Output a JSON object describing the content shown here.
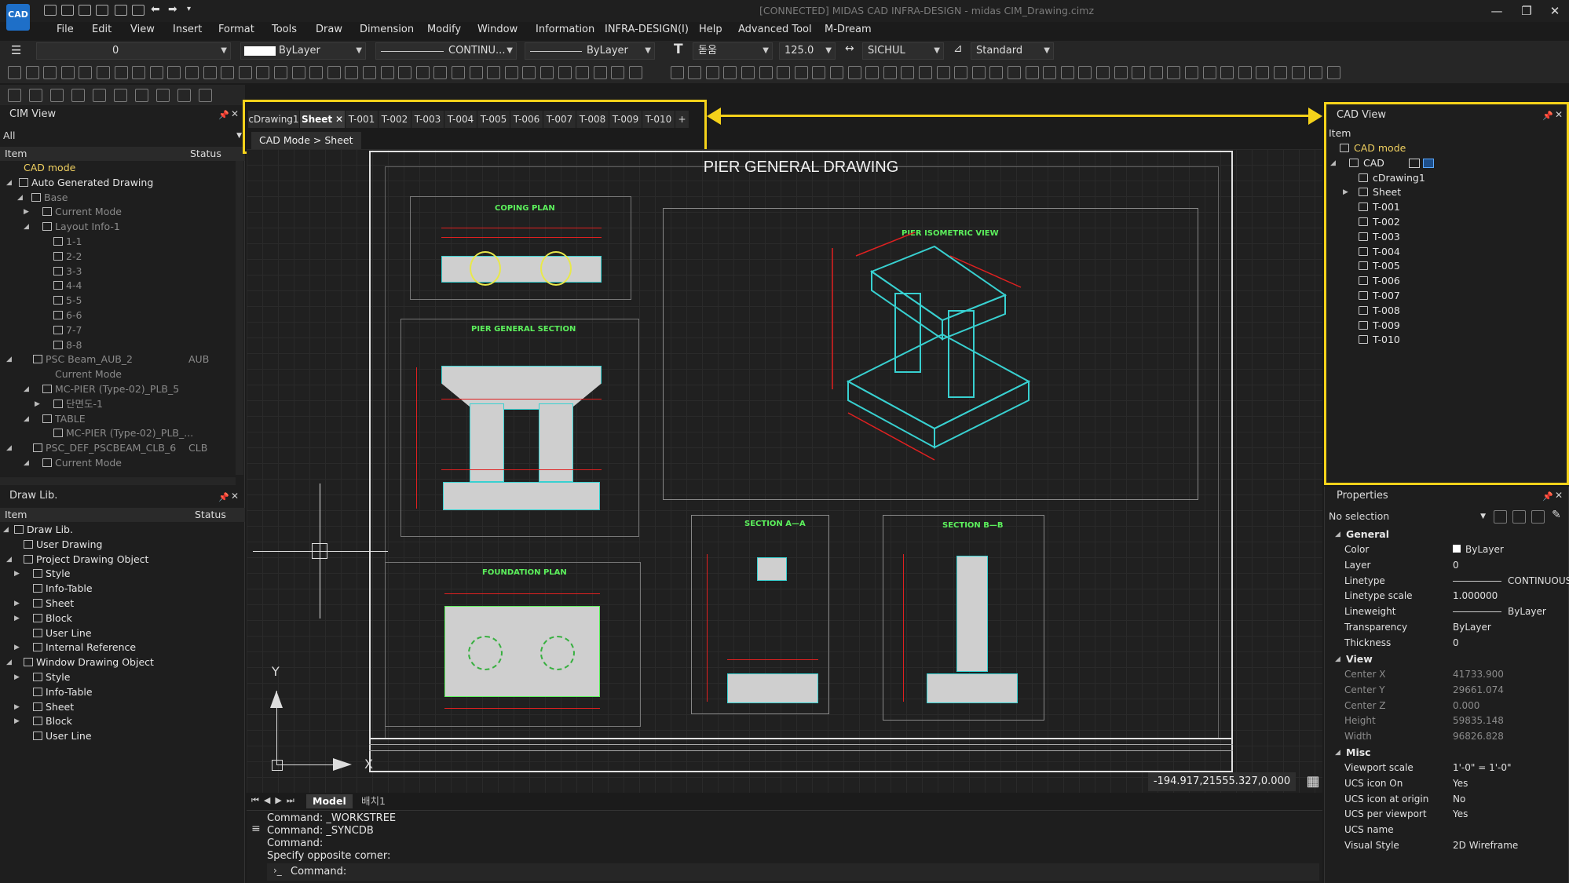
{
  "window": {
    "logo": "CAD",
    "title": "[CONNECTED] MIDAS CAD INFRA-DESIGN - midas CIM_Drawing.cimz",
    "controls": [
      "—",
      "❐",
      "✕"
    ]
  },
  "menu": [
    "File",
    "Edit",
    "View",
    "Insert",
    "Format",
    "Tools",
    "Draw",
    "Dimension",
    "Modify",
    "Window",
    "Information",
    "INFRA-DESIGN(I)",
    "Help",
    "Advanced Tool",
    "M-Dream"
  ],
  "toolbar": {
    "layer_value": "0",
    "color_value": "ByLayer",
    "linetype_value": "CONTINU...",
    "lineweight_value": "ByLayer",
    "text_style": "돋움",
    "text_height": "125.0",
    "dim_style": "SICHUL",
    "table_style": "Standard"
  },
  "cim_view": {
    "title": "CIM View",
    "filter": "All",
    "col_item": "Item",
    "col_status": "Status",
    "rows": [
      {
        "label": "CAD mode",
        "status": ""
      },
      {
        "label": "Auto Generated Drawing",
        "status": ""
      },
      {
        "label": "Base",
        "status": ""
      },
      {
        "label": "Current Mode",
        "status": ""
      },
      {
        "label": "Layout Info-1",
        "status": ""
      },
      {
        "label": "1-1",
        "status": ""
      },
      {
        "label": "2-2",
        "status": ""
      },
      {
        "label": "3-3",
        "status": ""
      },
      {
        "label": "4-4",
        "status": ""
      },
      {
        "label": "5-5",
        "status": ""
      },
      {
        "label": "6-6",
        "status": ""
      },
      {
        "label": "7-7",
        "status": ""
      },
      {
        "label": "8-8",
        "status": ""
      },
      {
        "label": "PSC Beam_AUB_2",
        "status": "AUB"
      },
      {
        "label": "Current Mode",
        "status": ""
      },
      {
        "label": "MC-PIER (Type-02)_PLB_5",
        "status": ""
      },
      {
        "label": "단면도-1",
        "status": ""
      },
      {
        "label": "TABLE",
        "status": ""
      },
      {
        "label": "MC-PIER (Type-02)_PLB_...",
        "status": ""
      },
      {
        "label": "PSC_DEF_PSCBEAM_CLB_6",
        "status": "CLB"
      },
      {
        "label": "Current Mode",
        "status": ""
      }
    ]
  },
  "draw_lib": {
    "title": "Draw Lib.",
    "col_item": "Item",
    "col_status": "Status",
    "rows": [
      "Draw Lib.",
      "User Drawing",
      "Project Drawing Object",
      "Style",
      "Info-Table",
      "Sheet",
      "Block",
      "User Line",
      "Internal Reference",
      "Window Drawing Object",
      "Style",
      "Info-Table",
      "Sheet",
      "Block",
      "User Line"
    ]
  },
  "tabs": [
    "cDrawing1",
    "Sheet",
    "T-001",
    "T-002",
    "T-003",
    "T-004",
    "T-005",
    "T-006",
    "T-007",
    "T-008",
    "T-009",
    "T-010",
    "+"
  ],
  "breadcrumb": "CAD Mode > Sheet",
  "drawing": {
    "title": "PIER GENERAL DRAWING",
    "labels": {
      "coping": "COPING PLAN",
      "general_section": "PIER GENERAL SECTION",
      "isometric": "PIER ISOMETRIC VIEW",
      "foundation": "FOUNDATION PLAN",
      "section_a": "SECTION A—A",
      "section_b": "SECTION B—B"
    },
    "axis_y": "Y",
    "axis_x": "X"
  },
  "coords": "-194.917,21555.327,0.000",
  "layout_tabs": [
    "Model",
    "배치1"
  ],
  "command": {
    "lines": [
      "Command:  _WORKSTREE",
      "Command:  _SYNCDB",
      "Command:",
      "Specify opposite corner:"
    ],
    "prompt": "Command:"
  },
  "cad_view": {
    "title": "CAD View",
    "col_item": "Item",
    "rows": [
      "CAD mode",
      "CAD",
      "cDrawing1",
      "Sheet",
      "T-001",
      "T-002",
      "T-003",
      "T-004",
      "T-005",
      "T-006",
      "T-007",
      "T-008",
      "T-009",
      "T-010"
    ]
  },
  "properties": {
    "title": "Properties",
    "selection": "No selection",
    "groups": {
      "general": "General",
      "view": "View",
      "misc": "Misc"
    },
    "general": [
      {
        "k": "Color",
        "v": "ByLayer"
      },
      {
        "k": "Layer",
        "v": "0"
      },
      {
        "k": "Linetype",
        "v": "CONTINUOUS"
      },
      {
        "k": "Linetype scale",
        "v": "1.000000"
      },
      {
        "k": "Lineweight",
        "v": "ByLayer"
      },
      {
        "k": "Transparency",
        "v": "ByLayer"
      },
      {
        "k": "Thickness",
        "v": "0"
      }
    ],
    "view": [
      {
        "k": "Center X",
        "v": "41733.900"
      },
      {
        "k": "Center Y",
        "v": "29661.074"
      },
      {
        "k": "Center Z",
        "v": "0.000"
      },
      {
        "k": "Height",
        "v": "59835.148"
      },
      {
        "k": "Width",
        "v": "96826.828"
      }
    ],
    "misc": [
      {
        "k": "Viewport scale",
        "v": "1'-0\" = 1'-0\""
      },
      {
        "k": "UCS icon On",
        "v": "Yes"
      },
      {
        "k": "UCS icon at origin",
        "v": "No"
      },
      {
        "k": "UCS per viewport",
        "v": "Yes"
      },
      {
        "k": "UCS name",
        "v": ""
      },
      {
        "k": "Visual Style",
        "v": "2D Wireframe"
      }
    ]
  },
  "colors": {
    "highlight": "#f5d21a",
    "accent_green": "#5cf05c",
    "accent_cyan": "#38d0d0",
    "dim_red": "#e02020"
  }
}
